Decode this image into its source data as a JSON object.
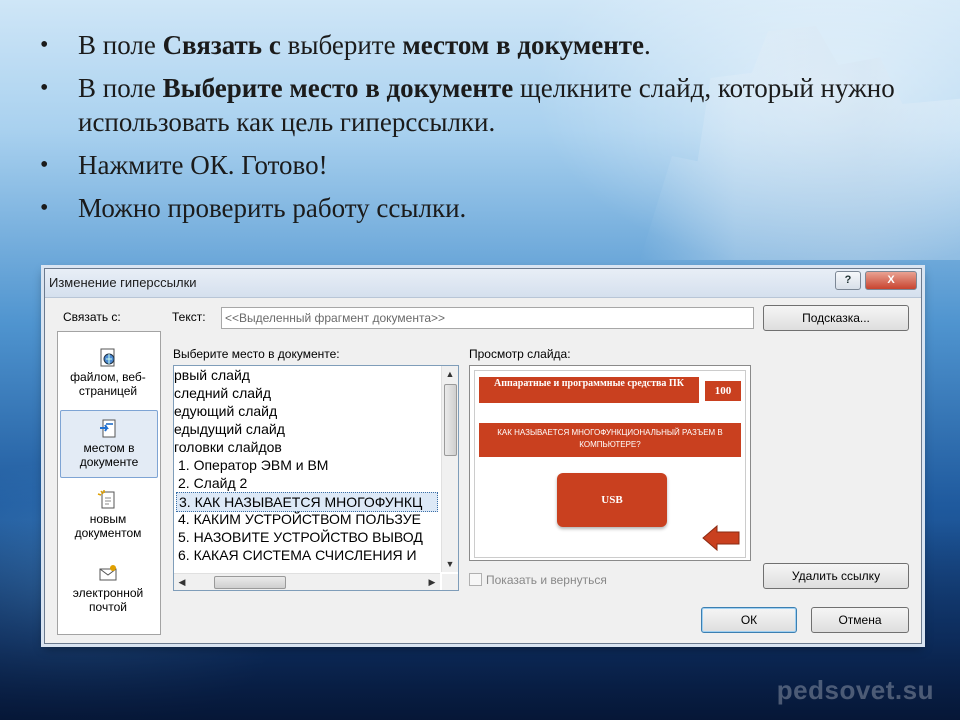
{
  "slide": {
    "bullets": [
      {
        "pre": "В поле ",
        "b1": "Связать с",
        "mid": " выберите ",
        "b2": "местом в документе",
        "post": "."
      },
      {
        "pre": "В поле ",
        "b1": "Выберите место в документе",
        "post": " щелкните слайд, который нужно использовать как цель гиперссылки."
      },
      {
        "text": "Нажмите ОК. Готово!"
      },
      {
        "text": "Можно проверить работу ссылки."
      }
    ],
    "watermark": "pedsovet.su"
  },
  "dialog": {
    "title": "Изменение гиперссылки",
    "help_button": "?",
    "close_button": "X",
    "link_to_label": "Связать с:",
    "text_label": "Текст:",
    "text_value": "<<Выделенный фрагмент документа>>",
    "tooltip_button": "Подсказка...",
    "select_place_label": "Выберите место в документе:",
    "preview_label": "Просмотр слайда:",
    "link_types": [
      {
        "label": "файлом, веб-страницей",
        "icon": "web-page-icon",
        "selected": false
      },
      {
        "label": "местом в документе",
        "icon": "place-in-document-icon",
        "selected": true
      },
      {
        "label": "новым документом",
        "icon": "new-document-icon",
        "selected": false
      },
      {
        "label": "электронной почтой",
        "icon": "email-icon",
        "selected": false
      }
    ],
    "tree_items": [
      "рвый слайд",
      "следний слайд",
      "едующий слайд",
      "едыдущий слайд",
      "головки слайдов",
      "1. Оператор ЭВМ и ВМ",
      "2. Слайд 2",
      "3. КАК НАЗЫВАЕТСЯ МНОГОФУНКЦ",
      "4. КАКИМ УСТРОЙСТВОМ ПОЛЬЗУЕ",
      "5. НАЗОВИТЕ УСТРОЙСТВО ВЫВОД",
      "6. КАКАЯ СИСТЕМА СЧИСЛЕНИЯ И"
    ],
    "selected_tree_index": 7,
    "preview": {
      "title": "Аппаратные и программные средства ПК",
      "score": "100",
      "question": "КАК НАЗЫВАЕТСЯ МНОГОФУНКЦИОНАЛЬНЫЙ РАЗЪЕМ В КОМПЬЮТЕРЕ?",
      "answer": "USB"
    },
    "show_and_return_label": "Показать и вернуться",
    "remove_link_button": "Удалить ссылку",
    "ok_button": "ОК",
    "cancel_button": "Отмена",
    "colors": {
      "accent": "#c9401f",
      "selection": "#dde9f7"
    }
  }
}
